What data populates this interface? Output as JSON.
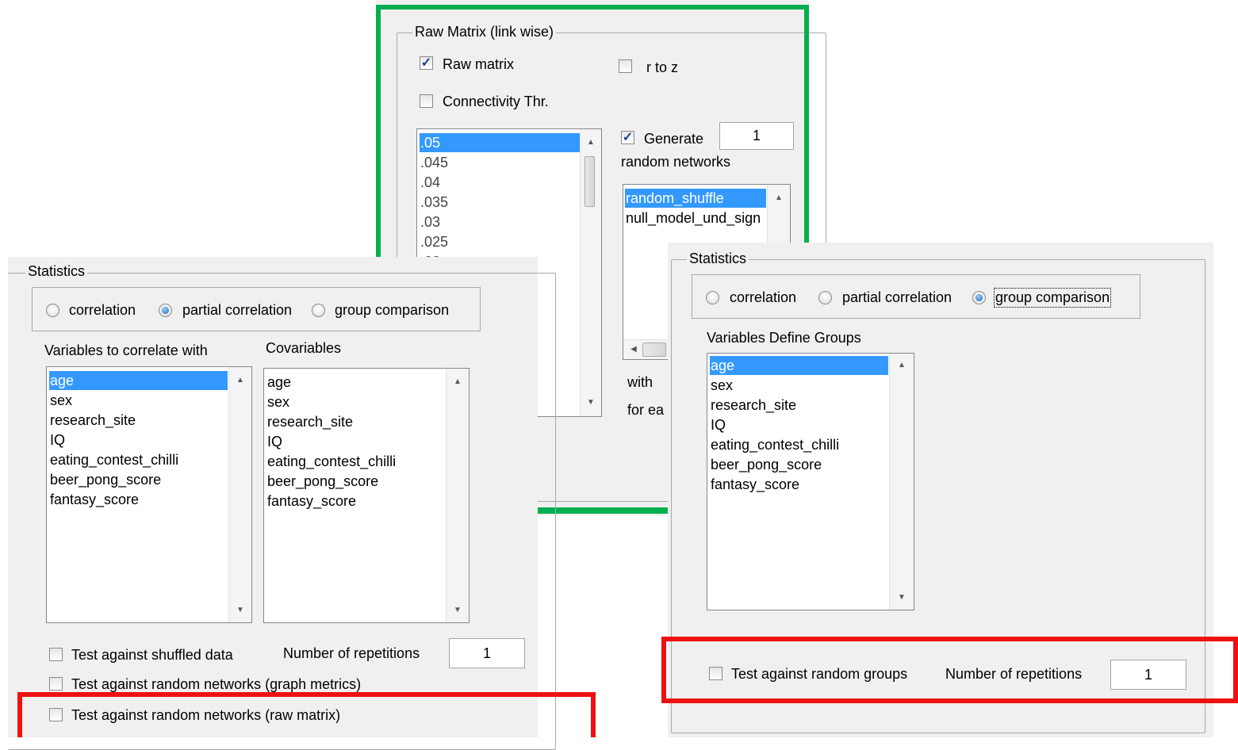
{
  "raw_panel": {
    "title": "Raw Matrix (link wise)",
    "raw_matrix": {
      "label": "Raw matrix",
      "checked": true
    },
    "r_to_z": {
      "label": "r to z",
      "checked": false
    },
    "connectivity_thr": {
      "label": "Connectivity Thr.",
      "checked": false
    },
    "thresholds": {
      "items": [
        ".05",
        ".045",
        ".04",
        ".035",
        ".03",
        ".025",
        ".02"
      ],
      "selected": ".05"
    },
    "generate": {
      "label": "Generate",
      "checked": true,
      "value": "1"
    },
    "random_networks_label": "random networks",
    "models": {
      "items": [
        "random_shuffle",
        "null_model_und_sign"
      ],
      "selected": "random_shuffle"
    },
    "with_label": "with",
    "for_each_label": "for ea"
  },
  "left_panel": {
    "title": "Statistics",
    "radios": [
      {
        "label": "correlation",
        "selected": false
      },
      {
        "label": "partial correlation",
        "selected": true
      },
      {
        "label": "group comparison",
        "selected": false
      }
    ],
    "variables_label": "Variables to correlate with",
    "covariables_label": "Covariables",
    "variables": [
      "age",
      "sex",
      "research_site",
      "IQ",
      "eating_contest_chilli",
      "beer_pong_score",
      "fantasy_score"
    ],
    "variables_selected": "age",
    "covariables": [
      "age",
      "sex",
      "research_site",
      "IQ",
      "eating_contest_chilli",
      "beer_pong_score",
      "fantasy_score"
    ],
    "shuffled": {
      "label": "Test against shuffled data",
      "checked": false
    },
    "repetitions_label": "Number of repetitions",
    "repetitions_value": "1",
    "graph_metrics": {
      "label": "Test against random networks (graph metrics)",
      "checked": false
    },
    "raw_matrix_test": {
      "label": "Test against random networks (raw matrix)",
      "checked": false
    }
  },
  "right_panel": {
    "title": "Statistics",
    "radios": [
      {
        "label": "correlation",
        "selected": false
      },
      {
        "label": "partial correlation",
        "selected": false
      },
      {
        "label": "group comparison",
        "selected": true
      }
    ],
    "groups_label": "Variables Define Groups",
    "variables": [
      "age",
      "sex",
      "research_site",
      "IQ",
      "eating_contest_chilli",
      "beer_pong_score",
      "fantasy_score"
    ],
    "variables_selected": "age",
    "random_groups": {
      "label": "Test against random groups",
      "checked": false
    },
    "repetitions_label": "Number of repetitions",
    "repetitions_value": "1"
  },
  "colors": {
    "highlight_red": "#ee1111",
    "highlight_green": "#00b050",
    "selection_blue": "#3399ff"
  }
}
